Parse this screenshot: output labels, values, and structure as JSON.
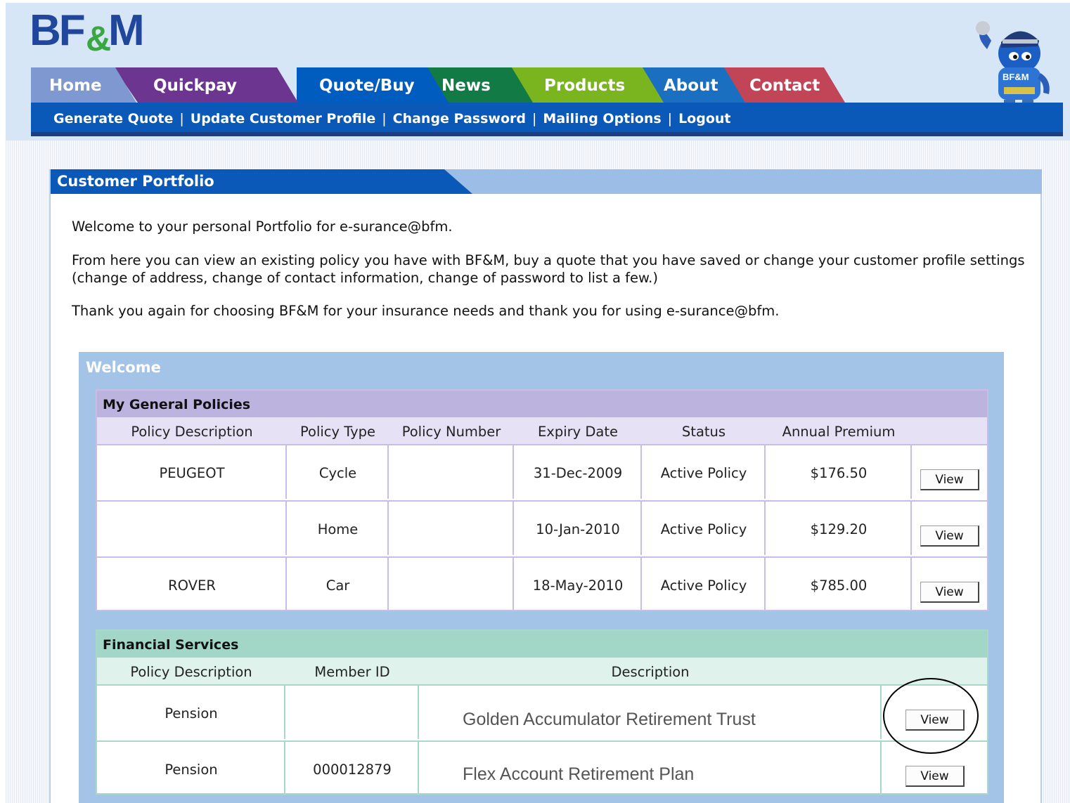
{
  "logo": {
    "part1": "BF",
    "amp": "&",
    "part2": "M"
  },
  "mascot": {
    "badge": "BF&M"
  },
  "tabs": [
    "Home",
    "Quickpay",
    "Quote/Buy",
    "News",
    "Products",
    "About",
    "Contact"
  ],
  "subnav": [
    "Generate Quote",
    "Update Customer Profile",
    "Change Password",
    "Mailing Options",
    "Logout"
  ],
  "subnav_separator": "|",
  "portfolio": {
    "title": "Customer Portfolio",
    "intro1": "Welcome to your personal Portfolio for e-surance@bfm.",
    "intro2": "From here you can view an existing policy you have with BF&M, buy a quote that you have saved or change your customer profile settings (change of address, change of contact information, change of password to list a few.)",
    "intro3": "Thank you again for choosing BF&M for your insurance needs and thank you for using e-surance@bfm."
  },
  "welcome": {
    "title": "Welcome"
  },
  "general": {
    "title": "My General Policies",
    "headers": [
      "Policy Description",
      "Policy Type",
      "Policy Number",
      "Expiry Date",
      "Status",
      "Annual Premium"
    ],
    "rows": [
      {
        "description": "PEUGEOT",
        "type": "Cycle",
        "number": "",
        "expiry": "31-Dec-2009",
        "status": "Active Policy",
        "premium": "$176.50",
        "action": "View"
      },
      {
        "description": "",
        "type": "Home",
        "number": "",
        "expiry": "10-Jan-2010",
        "status": "Active Policy",
        "premium": "$129.20",
        "action": "View"
      },
      {
        "description": "ROVER",
        "type": "Car",
        "number": "",
        "expiry": "18-May-2010",
        "status": "Active Policy",
        "premium": "$785.00",
        "action": "View"
      }
    ]
  },
  "financial": {
    "title": "Financial Services",
    "headers": [
      "Policy Description",
      "Member ID",
      "Description"
    ],
    "rows": [
      {
        "description": "Pension",
        "member_id": "",
        "plan": "Golden Accumulator Retirement Trust",
        "action": "View"
      },
      {
        "description": "Pension",
        "member_id": "000012879",
        "plan": "Flex Account Retirement Plan",
        "action": "View"
      }
    ]
  },
  "colors": {
    "nav_blue": "#0a58b8",
    "tab_home": "#7e98d2",
    "tab_quickpay": "#6b3590",
    "tab_quote": "#005dbf",
    "tab_news": "#127a45",
    "tab_products": "#7ab51f",
    "tab_about": "#1a6fc0",
    "tab_contact": "#c24457",
    "general_header": "#bdb3df",
    "financial_header": "#a2d6c7"
  }
}
